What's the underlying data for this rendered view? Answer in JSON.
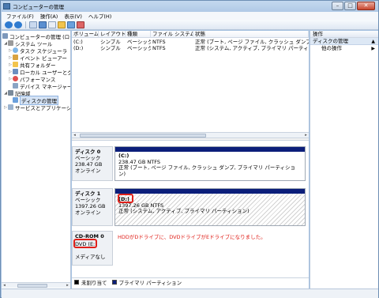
{
  "window": {
    "title": "コンピューターの管理",
    "min": "–",
    "max": "□",
    "close": "✕"
  },
  "menu": [
    "ファイル(F)",
    "操作(A)",
    "表示(V)",
    "ヘルプ(H)"
  ],
  "tree": {
    "root": "コンピューターの管理 (ローカ",
    "system_tools": "システム ツール",
    "task_scheduler": "タスク スケジューラ",
    "event_viewer": "イベント ビューアー",
    "shared_folders": "共有フォルダー",
    "local_users": "ローカル ユーザーとグ",
    "performance": "パフォーマンス",
    "device_manager": "デバイス マネージャー",
    "storage": "記憶域",
    "disk_management": "ディスクの管理",
    "services": "サービスとアプリケーショ"
  },
  "volume_table": {
    "headers": [
      "ボリューム",
      "レイアウト",
      "種類",
      "ファイル システム",
      "状態"
    ],
    "rows": [
      [
        "(C:)",
        "シンプル",
        "ベーシック",
        "NTFS",
        "正常 (ブート, ページ ファイル, クラッシュ ダンプ, プライ"
      ],
      [
        "(D:)",
        "シンプル",
        "ベーシック",
        "NTFS",
        "正常 (システム, アクティブ, プライマリ パーティション)"
      ]
    ]
  },
  "disks": [
    {
      "name": "ディスク 0",
      "type": "ベーシック",
      "size": "238.47 GB",
      "status": "オンライン",
      "part_label": "(C:)",
      "part_size": "238.47 GB NTFS",
      "part_status": "正常 (ブート, ページ ファイル, クラッシュ ダンプ, プライマリ パーティション)"
    },
    {
      "name": "ディスク 1",
      "type": "ベーシック",
      "size": "1397.26 GB",
      "status": "オンライン",
      "part_label": "(D:)",
      "part_size": "1397.26 GB NTFS",
      "part_status": "正常 (システム, アクティブ, プライマリ パーティション)"
    },
    {
      "name": "CD-ROM 0",
      "type": "DVD (E:)",
      "status": "メディアなし"
    }
  ],
  "annotation": "HDDがDドライブに、DVDドライブがEドライブになりました。",
  "legend": {
    "unallocated": "未割り当て",
    "primary": "プライマリ パーティション"
  },
  "colors": {
    "band": "#0b1e7a",
    "annotation": "#e0201a",
    "unallocated": "#000000"
  },
  "ops": {
    "header": "操作",
    "section": "ディスクの管理",
    "more": "他の操作"
  }
}
